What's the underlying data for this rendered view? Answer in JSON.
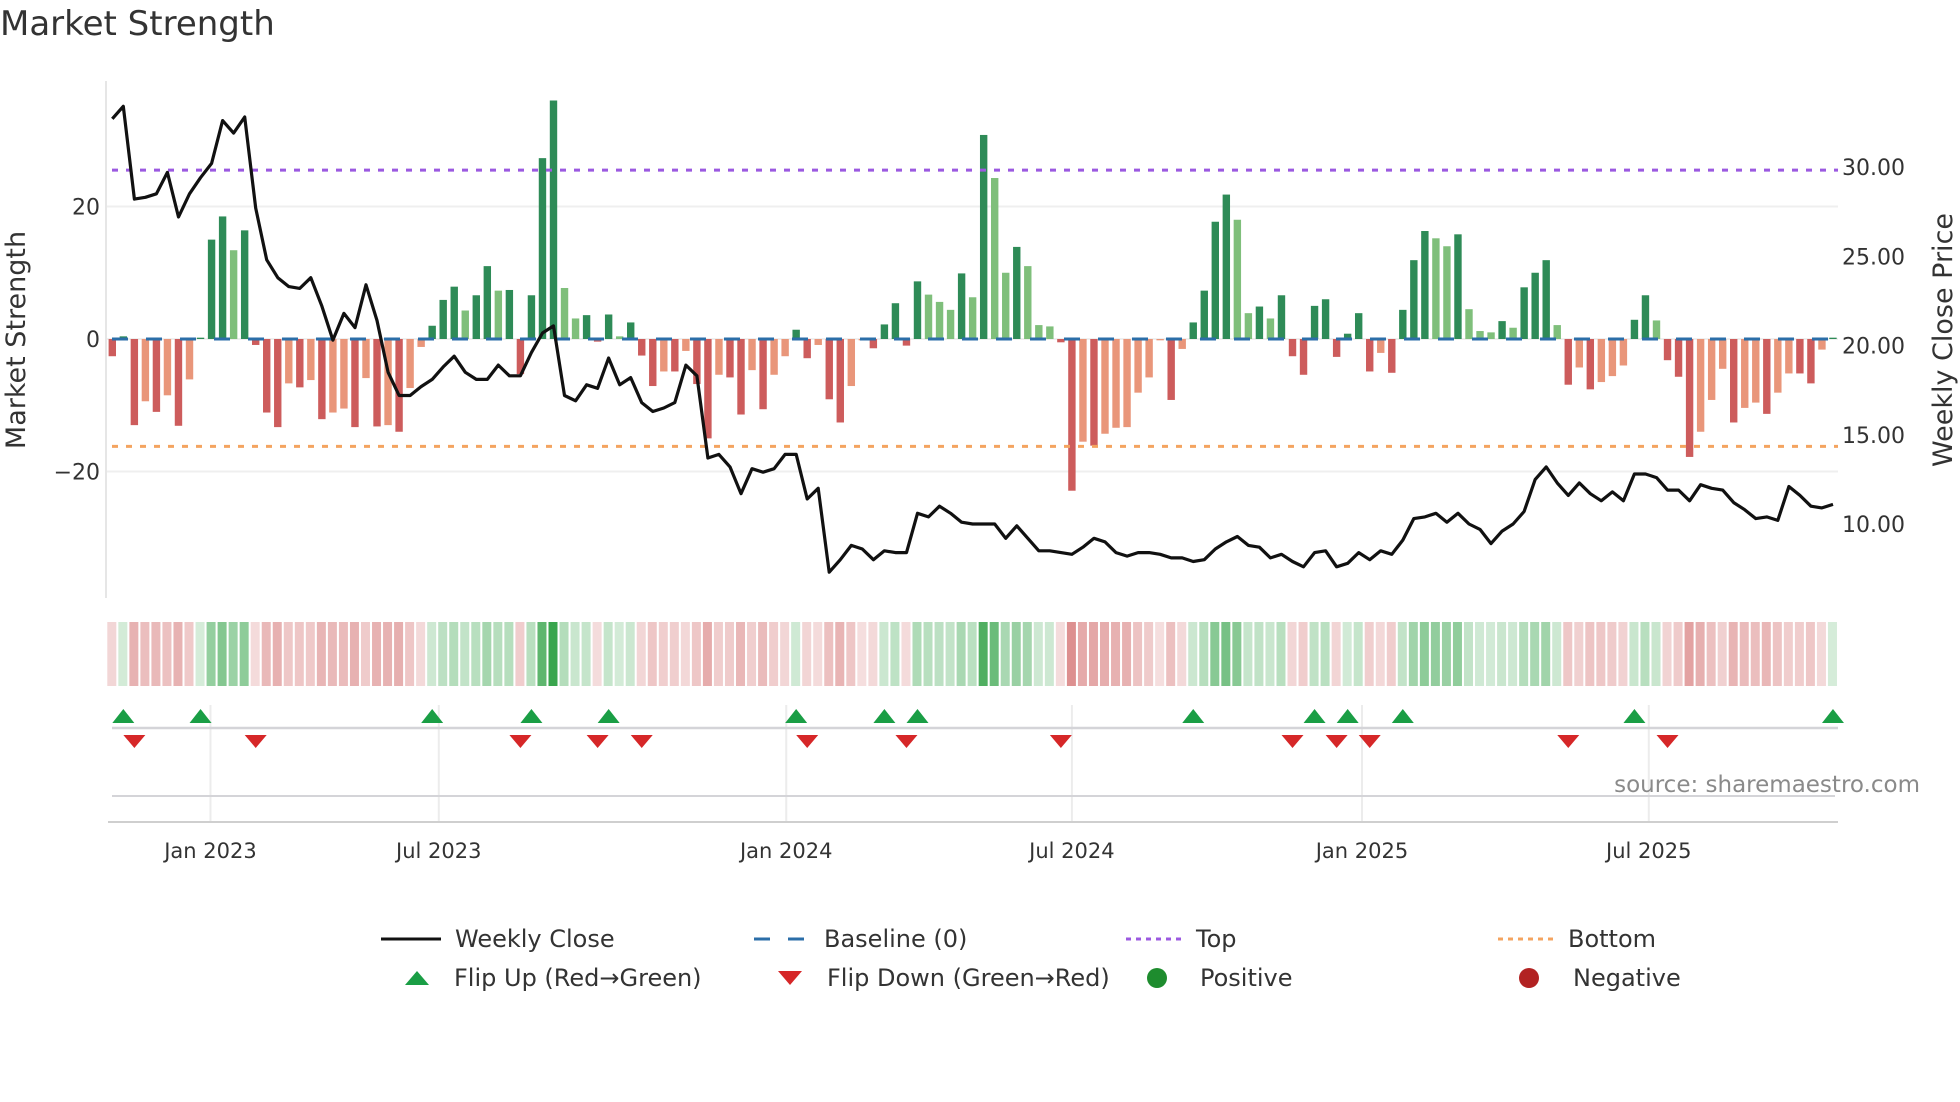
{
  "title": "Market Strength",
  "source": "source: sharemaestro.com",
  "colors": {
    "pos_strong": "#2e8b57",
    "pos_weak": "#7fbf7b",
    "neg_strong": "#cd5c5c",
    "neg_weak": "#e9967a",
    "close": "#111111",
    "baseline": "#2b6ea8",
    "top": "#9b59e0",
    "bottom": "#f4a460",
    "flip_up": "#1a9e45",
    "flip_down": "#d62728",
    "positive": "#1e8c2e",
    "negative": "#b22222"
  },
  "legend": {
    "close": "Weekly Close",
    "baseline": "Baseline (0)",
    "top": "Top",
    "bottom": "Bottom",
    "flip_up": "Flip Up (Red→Green)",
    "flip_down": "Flip Down (Green→Red)",
    "positive": "Positive",
    "negative": "Negative"
  },
  "chart_data": {
    "type": "bar",
    "title": "Market Strength",
    "ylabel": "Market Strength",
    "y2label": "Weekly Close Price",
    "ylim": [
      -39,
      39
    ],
    "y2lim": [
      6,
      34
    ],
    "yticks": [
      {
        "v": 20,
        "label": "20"
      },
      {
        "v": 0,
        "label": "0"
      },
      {
        "v": -20,
        "label": "−20"
      }
    ],
    "y2ticks": [
      {
        "v": 30,
        "label": "30.00"
      },
      {
        "v": 25,
        "label": "25.00"
      },
      {
        "v": 20,
        "label": "20.00"
      },
      {
        "v": 15,
        "label": "15.00"
      },
      {
        "v": 10,
        "label": "10.00"
      }
    ],
    "xticks": [
      {
        "week": 8.9,
        "label": "Jan 2023"
      },
      {
        "week": 29.6,
        "label": "Jul 2023"
      },
      {
        "week": 61.1,
        "label": "Jan 2024"
      },
      {
        "week": 87.0,
        "label": "Jul 2024"
      },
      {
        "week": 113.3,
        "label": "Jan 2025"
      },
      {
        "week": 139.3,
        "label": "Jul 2025"
      }
    ],
    "top_threshold": 25.5,
    "bottom_threshold": -16.2,
    "strength": [
      -2.6,
      0.4,
      -13,
      -9.4,
      -11,
      -8.5,
      -13.1,
      -6.1,
      0.2,
      15,
      18.5,
      13.4,
      16.4,
      -0.9,
      -11.1,
      -13.3,
      -6.7,
      -7.3,
      -6.2,
      -12.1,
      -11.1,
      -10.5,
      -13.3,
      -5.9,
      -13.2,
      -13,
      -14,
      -7.4,
      -1.2,
      2,
      5.9,
      7.9,
      4.3,
      6.6,
      11,
      7.3,
      7.4,
      -5.3,
      6.6,
      27.3,
      36,
      7.7,
      3.1,
      3.6,
      -0.4,
      3.7,
      0.4,
      2.5,
      -2.5,
      -7.1,
      -4.9,
      -4.9,
      -1.8,
      -6.8,
      -15,
      -5.4,
      -5.8,
      -11.4,
      -4.7,
      -10.6,
      -5.4,
      -2.6,
      1.4,
      -2.9,
      -0.9,
      -9.1,
      -12.6,
      -7.1,
      -0.2,
      -1.4,
      2.2,
      5.4,
      -1,
      8.7,
      6.7,
      5.6,
      4.4,
      9.9,
      6.3,
      30.8,
      24.3,
      10,
      13.9,
      11,
      2.1,
      1.9,
      -0.5,
      -22.9,
      -15.5,
      -16.1,
      -14.3,
      -13.4,
      -13.3,
      -8.1,
      -5.8,
      -0.2,
      -9.2,
      -1.5,
      2.5,
      7.3,
      17.7,
      21.8,
      18,
      3.9,
      4.9,
      3.1,
      6.6,
      -2.6,
      -5.4,
      5,
      6,
      -2.7,
      0.8,
      3.9,
      -4.9,
      -2.1,
      -5.1,
      4.4,
      11.9,
      16.3,
      15.2,
      14,
      15.8,
      4.5,
      1.2,
      1,
      2.7,
      1.7,
      7.8,
      10,
      11.9,
      2.1,
      -6.9,
      -4.3,
      -7.6,
      -6.5,
      -5.6,
      -4,
      2.9,
      6.6,
      2.8,
      -3.2,
      -5.7,
      -17.8,
      -14,
      -9.2,
      -4.5,
      -12.6,
      -10.4,
      -9.6,
      -11.3,
      -8.1,
      -5.2,
      -5.2,
      -6.7,
      -1.6,
      0.2
    ],
    "close": [
      32.7,
      33.4,
      28.2,
      28.3,
      28.5,
      29.7,
      27.2,
      28.5,
      29.4,
      30.2,
      32.6,
      31.9,
      32.8,
      27.7,
      24.8,
      23.8,
      23.3,
      23.2,
      23.8,
      22.2,
      20.3,
      21.8,
      21,
      23.4,
      21.4,
      18.5,
      17.2,
      17.2,
      17.7,
      18.1,
      18.8,
      19.4,
      18.5,
      18.1,
      18.1,
      18.9,
      18.3,
      18.3,
      19.6,
      20.7,
      21.1,
      17.2,
      16.9,
      17.8,
      17.6,
      19.3,
      17.8,
      18.2,
      16.8,
      16.3,
      16.5,
      16.8,
      18.9,
      18.3,
      13.7,
      13.9,
      13.2,
      11.7,
      13.1,
      12.9,
      13.1,
      13.9,
      13.9,
      11.4,
      12,
      7.3,
      8,
      8.8,
      8.6,
      8,
      8.5,
      8.4,
      8.4,
      10.6,
      10.4,
      11,
      10.6,
      10.1,
      10,
      10,
      10,
      9.2,
      9.9,
      9.2,
      8.5,
      8.5,
      8.4,
      8.3,
      8.7,
      9.2,
      9,
      8.4,
      8.2,
      8.4,
      8.4,
      8.3,
      8.1,
      8.1,
      7.9,
      8,
      8.6,
      9,
      9.3,
      8.8,
      8.7,
      8.1,
      8.3,
      7.9,
      7.6,
      8.4,
      8.5,
      7.6,
      7.8,
      8.4,
      8,
      8.5,
      8.3,
      9.1,
      10.3,
      10.4,
      10.6,
      10.1,
      10.6,
      10,
      9.7,
      8.9,
      9.6,
      10,
      10.7,
      12.5,
      13.2,
      12.3,
      11.6,
      12.3,
      11.7,
      11.3,
      11.8,
      11.3,
      12.8,
      12.8,
      12.6,
      11.9,
      11.9,
      11.3,
      12.2,
      12,
      11.9,
      11.2,
      10.8,
      10.3,
      10.4,
      10.2,
      12.1,
      11.6,
      11,
      10.9,
      11.1
    ],
    "flip_up_weeks": [
      1,
      8,
      29,
      38,
      45,
      62,
      70,
      73,
      98,
      109,
      112,
      117,
      138,
      156
    ],
    "flip_down_weeks": [
      2,
      13,
      37,
      44,
      48,
      63,
      72,
      86,
      107,
      111,
      114,
      132,
      141
    ]
  }
}
